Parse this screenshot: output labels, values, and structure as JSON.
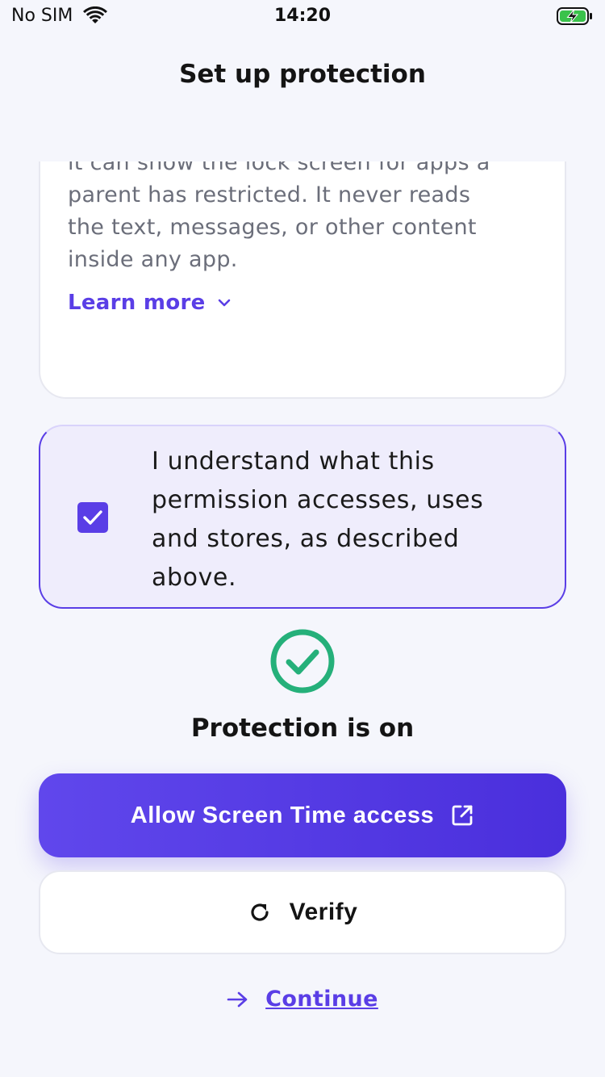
{
  "status_bar": {
    "carrier": "No SIM",
    "time": "14:20",
    "wifi_icon": "wifi-icon",
    "battery_icon": "battery-charging-icon"
  },
  "header": {
    "title": "Set up protection"
  },
  "info_card": {
    "text": "Time (Family Controls) permission so\nit can show the lock screen for apps a\nparent has restricted. It never reads\nthe text, messages, or other content\ninside any app.",
    "learn_more_label": "Learn more",
    "learn_more_icon": "chevron-down-icon"
  },
  "consent": {
    "checked": true,
    "text": "I understand what this\npermission accesses, uses\nand stores, as described\nabove."
  },
  "status": {
    "icon": "check-circle-icon",
    "label": "Protection is on"
  },
  "actions": {
    "primary_label": "Allow Screen Time access",
    "primary_icon": "external-link-icon",
    "verify_label": "Verify",
    "verify_icon": "refresh-icon",
    "continue_label": "Continue",
    "continue_icon": "arrow-right-icon"
  },
  "colors": {
    "accent": "#5a3ee6",
    "success": "#25b07a",
    "background": "#f5f6fc"
  }
}
